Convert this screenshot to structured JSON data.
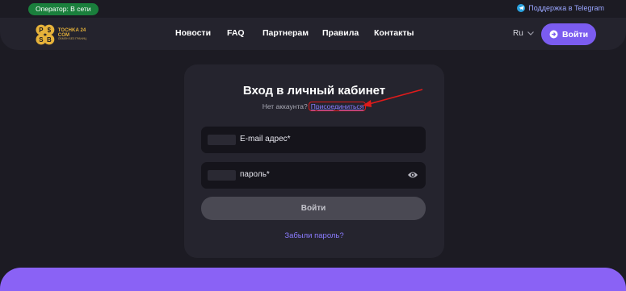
{
  "topbar": {
    "operator_status": "Оператор: В сети",
    "telegram_support": "Поддержка в Telegram"
  },
  "logo": {
    "name": "TOCHKA 24 COM",
    "tagline": "ОБМЕН БЕЗ ГРАНИЦ"
  },
  "nav": {
    "items": [
      {
        "label": "Новости"
      },
      {
        "label": "FAQ"
      },
      {
        "label": "Партнерам"
      },
      {
        "label": "Правила"
      },
      {
        "label": "Контакты"
      }
    ]
  },
  "header": {
    "language": "Ru",
    "login_button": "Войти"
  },
  "login_form": {
    "title": "Вход в личный кабинет",
    "no_account_text": "Нет аккаунта?",
    "join_link": "Присоединиться",
    "email_placeholder": "E-mail адрес*",
    "password_placeholder": "пароль*",
    "submit_label": "Войти",
    "forgot_password": "Забыли пароль?"
  },
  "colors": {
    "background": "#1c1b23",
    "accent": "#7b5cf0",
    "status_green": "#1a7f3c",
    "link": "#8b7cff",
    "annotation_red": "#e01b1b"
  }
}
